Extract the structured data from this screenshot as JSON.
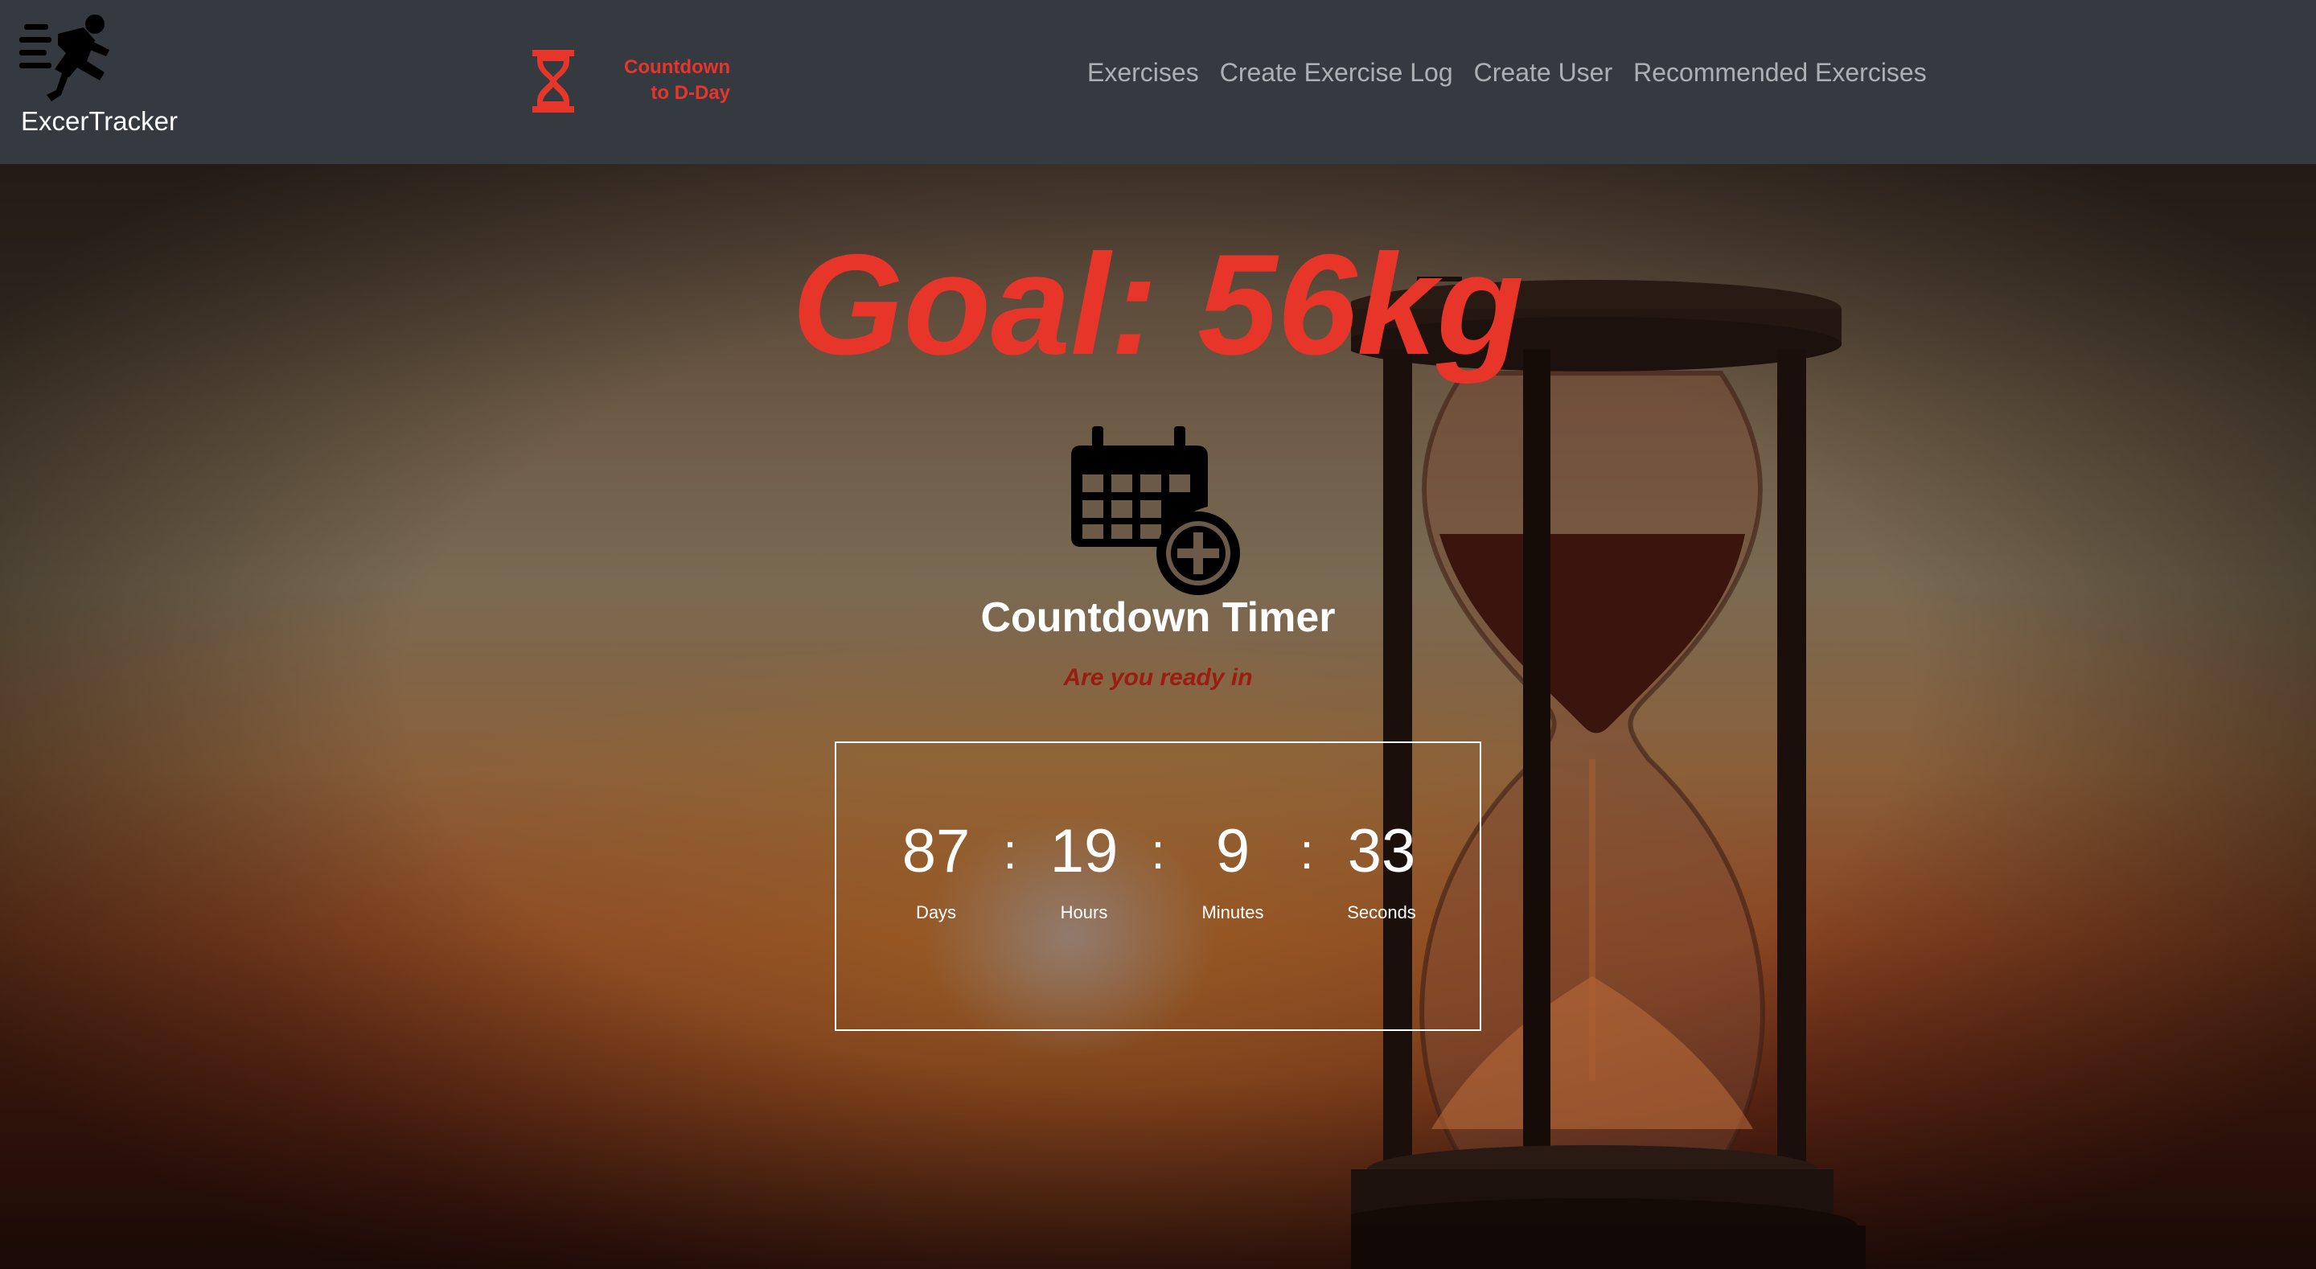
{
  "navbar": {
    "brand": "ExcerTracker",
    "countdown_link": "Countdown\nto D-Day",
    "links": [
      {
        "label": "Exercises"
      },
      {
        "label": "Create Exercise Log"
      },
      {
        "label": "Create User"
      },
      {
        "label": "Recommended Exercises"
      }
    ]
  },
  "hero": {
    "goal": "Goal: 56kg",
    "timer_heading": "Countdown Timer",
    "timer_subtitle": "Are you ready in",
    "timer": {
      "days": "87",
      "hours": "19",
      "minutes": "9",
      "seconds": "33",
      "days_label": "Days",
      "hours_label": "Hours",
      "minutes_label": "Minutes",
      "seconds_label": "Seconds",
      "separator": ":"
    }
  },
  "icons": {
    "brand": "running-person-icon",
    "countdown": "hourglass-icon",
    "calendar": "calendar-plus-icon"
  },
  "colors": {
    "navbar_bg": "#343a40",
    "accent_red": "#e8352a",
    "subtitle_red": "#9a1c12",
    "nav_link": "rgba(255,255,255,0.6)"
  }
}
